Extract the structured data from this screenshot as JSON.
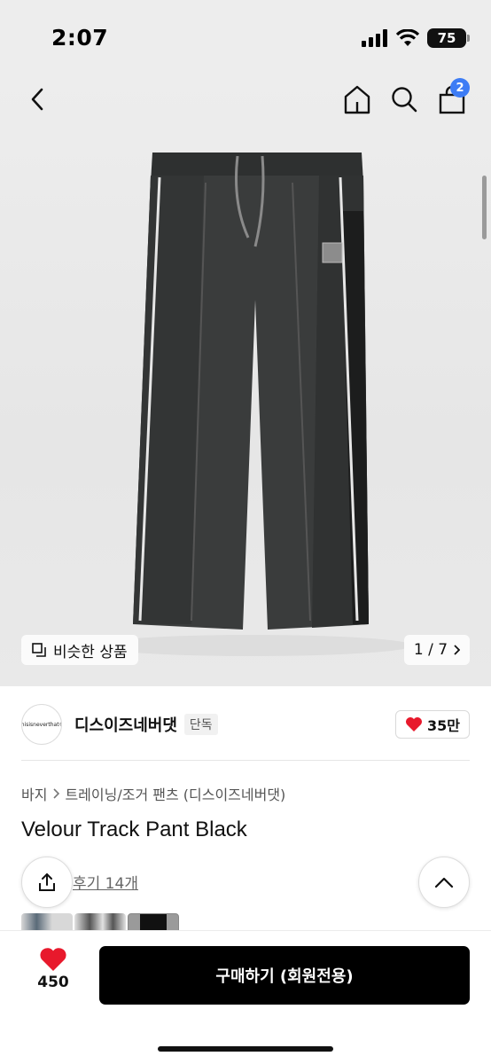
{
  "status_bar": {
    "time": "2:07",
    "battery": "75"
  },
  "header": {
    "cart_count": "2"
  },
  "gallery": {
    "similar_label": "비슷한 상품",
    "pager": "1 / 7"
  },
  "brand": {
    "logo_text": "thisisneverthat®",
    "name": "디스이즈네버댓",
    "exclusive_badge": "단독",
    "likes": "35만"
  },
  "breadcrumb": {
    "category": "바지",
    "subcategory": "트레이닝/조거 팬츠 (디스이즈네버댓)"
  },
  "product": {
    "name": "Velour Track Pant Black",
    "reviews": "후기 14개"
  },
  "bottom": {
    "like_count": "450",
    "buy_label": "구매하기 (회원전용)"
  },
  "colors": {
    "accent_badge": "#3d7cf5",
    "heart": "#e8192c",
    "buy_bg": "#000000"
  }
}
